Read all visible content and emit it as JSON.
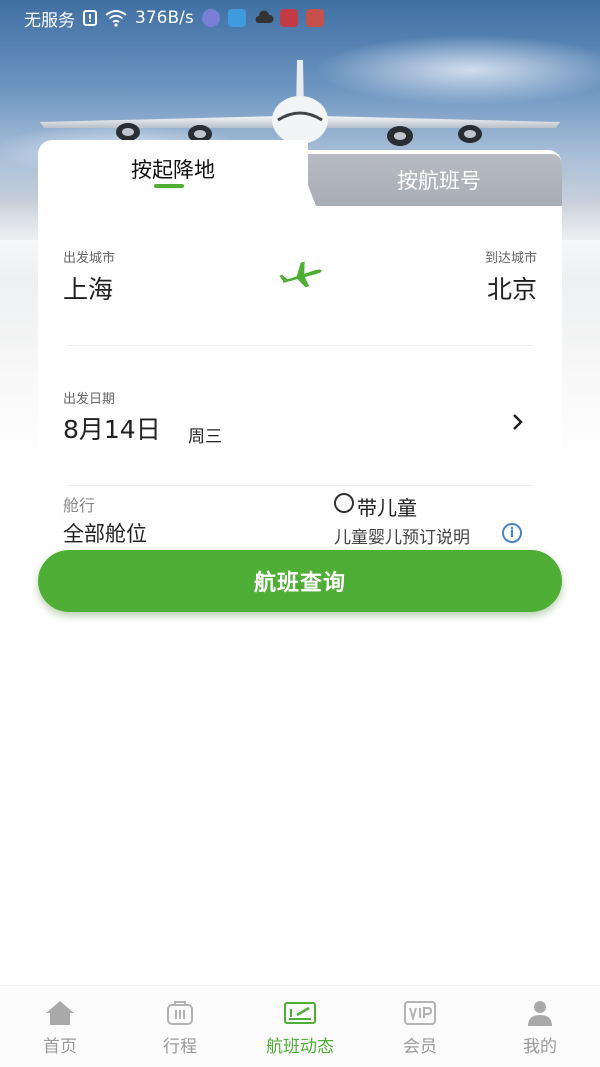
{
  "status_bar": {
    "carrier": "无服务",
    "speed": "376B/s"
  },
  "tabs": {
    "active": "按起降地",
    "inactive": "按航班号"
  },
  "route": {
    "departure_label": "出发城市",
    "departure_city": "上海",
    "arrival_label": "到达城市",
    "arrival_city": "北京"
  },
  "date": {
    "label": "出发日期",
    "value": "8月14日",
    "weekday": "周三"
  },
  "cabin": {
    "label": "舱行",
    "value": "全部舱位"
  },
  "child": {
    "label": "带儿童",
    "note": "儿童婴儿预订说明"
  },
  "search_button": "航班查询",
  "nav": {
    "items": [
      {
        "label": "首页",
        "icon": "home-icon"
      },
      {
        "label": "行程",
        "icon": "luggage-icon"
      },
      {
        "label": "航班动态",
        "icon": "flight-board-icon"
      },
      {
        "label": "会员",
        "icon": "vip-icon"
      },
      {
        "label": "我的",
        "icon": "user-icon"
      }
    ],
    "active_index": 2
  },
  "colors": {
    "accent": "#4fae35",
    "info": "#4a84c4"
  }
}
